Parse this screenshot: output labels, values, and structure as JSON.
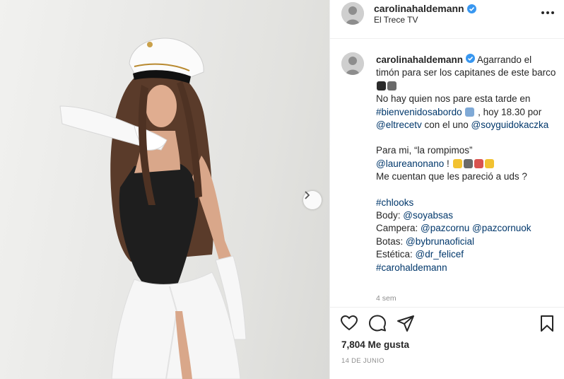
{
  "post_image": {
    "alt_icon": "photo",
    "next_icon": "chevron-right-icon"
  },
  "header": {
    "username": "carolinahaldemann",
    "subtitle": "El Trece TV",
    "more_icon": "more-icon"
  },
  "caption": {
    "username": "carolinahaldemann",
    "line1": "Agarrando el timón para ser los capitanes de este barco",
    "line2a": "No hay quien nos pare esta tarde en ",
    "hashtag1": "#bienvenidosabordo",
    "line2b": " , hoy 18.30 por ",
    "mention1": "@eltrecetv",
    "line2c": " con el uno ",
    "mention2": "@soyguidokaczka",
    "line3": "Para mi, “la rompimos”",
    "mention3": "@laureanonano",
    "line3b": " ! ",
    "line4": "Me cuentan que les pareció a uds ?",
    "hashtag2": "#chlooks",
    "body_label": "Body: ",
    "body_link": "@soyabsas",
    "campera_label": "Campera: ",
    "campera_link1": "@pazcornu",
    "campera_link2": "@pazcornuok",
    "botas_label": "Botas: ",
    "botas_link": "@bybrunaoficial",
    "estetica_label": "Estética: ",
    "estetica_link": "@dr_felicef",
    "hashtag3": "#carohaldemann",
    "time_ago": "4 sem"
  },
  "actions": {
    "like_icon": "heart-icon",
    "comment_icon": "comment-icon",
    "share_icon": "share-icon",
    "save_icon": "bookmark-icon"
  },
  "likes": "7,804 Me gusta",
  "date": "14 DE JUNIO",
  "colors": {
    "link": "#00376b",
    "text": "#262626",
    "muted": "#8e8e8e",
    "verified": "#3897f0"
  }
}
